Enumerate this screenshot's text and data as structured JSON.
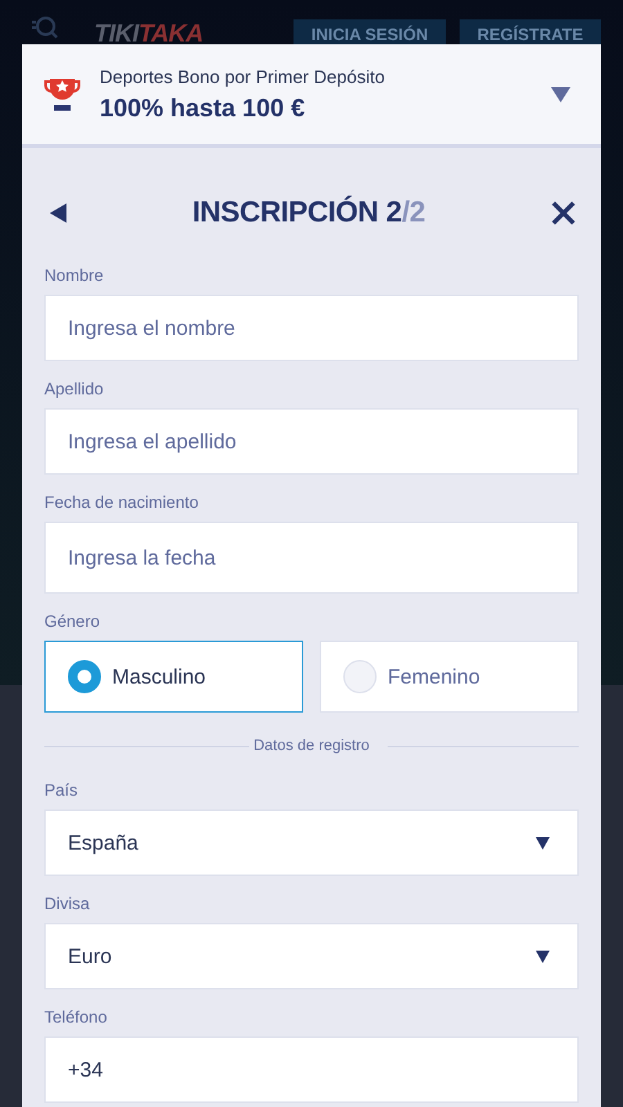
{
  "header": {
    "logo": [
      {
        "text": "TIKI",
        "color": "#5a5e6c"
      },
      {
        "text": "TAKA",
        "color": "#8a3032"
      }
    ],
    "buttons": [
      "INICIA SESIÓN",
      "REGÍSTRATE"
    ]
  },
  "bonus": {
    "subtitle": "Deportes Bono por Primer Depósito",
    "title": "100% hasta 100 €"
  },
  "form": {
    "title": "INSCRIPCIÓN 2",
    "title_suffix": "/2",
    "fields": [
      {
        "kind": "text",
        "label": "Nombre",
        "placeholder": "Ingresa el nombre"
      },
      {
        "kind": "text",
        "label": "Apellido",
        "placeholder": "Ingresa el apellido"
      },
      {
        "kind": "text",
        "label": "Fecha de nacimiento",
        "placeholder": "Ingresa la fecha"
      },
      {
        "kind": "radio",
        "label": "Género",
        "options": [
          {
            "label": "Masculino",
            "selected": true
          },
          {
            "label": "Femenino",
            "selected": false
          }
        ]
      },
      {
        "kind": "divider",
        "label": "Datos de registro"
      },
      {
        "kind": "select",
        "label": "País",
        "value": "España"
      },
      {
        "kind": "select",
        "label": "Divisa",
        "value": "Euro"
      },
      {
        "kind": "text",
        "label": "Teléfono",
        "value": "+34"
      }
    ]
  }
}
